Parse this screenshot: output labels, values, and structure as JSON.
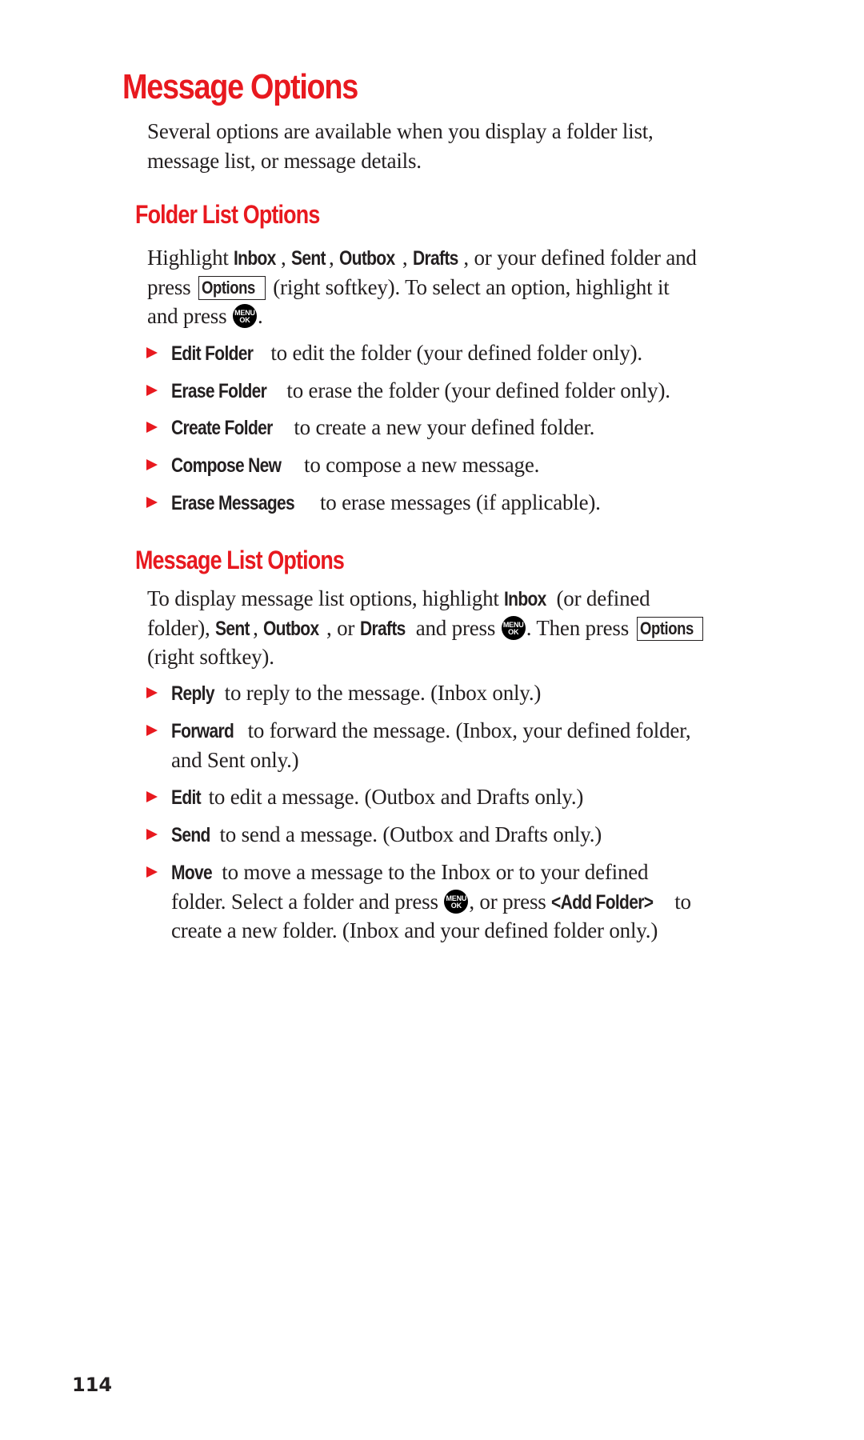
{
  "page": {
    "title": "Message Options",
    "intro": {
      "line1": "Several options are available when you display a folder list,",
      "line2": "message list, or message details."
    },
    "page_number": "114",
    "accent_color": "#e8191f"
  },
  "folder_list": {
    "heading": "Folder List Options",
    "para": {
      "l1_a": "Highlight ",
      "l1_inbox": "Inbox",
      "l1_c1": ", ",
      "l1_sent": "Sent",
      "l1_c2": ", ",
      "l1_outbox": "Outbox",
      "l1_c3": ", ",
      "l1_drafts": "Drafts",
      "l1_b": ", or your defined folder and",
      "l2_a": "press ",
      "l2_softkey": "Options",
      "l2_b": " (right softkey). To select an option, highlight it",
      "l3_a": "and press ",
      "l3_b": "."
    },
    "items": [
      {
        "term": "Edit Folder",
        "desc": " to edit the folder (your defined folder only)."
      },
      {
        "term": "Erase Folder",
        "desc": " to erase the folder (your defined folder only)."
      },
      {
        "term": "Create Folder",
        "desc": " to create a new your defined folder."
      },
      {
        "term": "Compose New",
        "desc": " to compose a new message."
      },
      {
        "term": "Erase Messages",
        "desc": " to erase messages (if applicable)."
      }
    ]
  },
  "message_list": {
    "heading": "Message List Options",
    "para": {
      "l1_a": "To display message list options, highlight ",
      "l1_inbox": "Inbox",
      "l1_b": " (or defined",
      "l2_a": "folder), ",
      "l2_sent": "Sent",
      "l2_c1": ", ",
      "l2_outbox": "Outbox",
      "l2_c2": ", or ",
      "l2_drafts": "Drafts",
      "l2_b": " and press ",
      "l2_c": ". Then press ",
      "l2_softkey": "Options",
      "l3": "(right softkey)."
    },
    "items": [
      {
        "term": "Reply",
        "desc": " to reply to the message. (Inbox only.)"
      },
      {
        "term": "Forward",
        "desc": " to forward the message. (Inbox, your defined folder,",
        "cont": "and Sent only.)"
      },
      {
        "term": "Edit",
        "desc": " to edit a message. (Outbox and Drafts only.)"
      },
      {
        "term": "Send",
        "desc": " to send a message. (Outbox and Drafts only.)"
      },
      {
        "term": "Move",
        "desc": " to move a message to the Inbox or to your defined",
        "cont_a": "folder. Select a folder and press ",
        "cont_b": ", or press ",
        "cont_term": "<Add Folder>",
        "cont_c": " to",
        "cont2": "create a new folder. (Inbox and your defined folder only.)"
      }
    ]
  },
  "icons": {
    "menu_ok": {
      "name": "menu-ok-key-icon",
      "line1": "MENU",
      "line2": "OK"
    },
    "bullet": {
      "name": "red-triangle-bullet-icon",
      "glyph": "▶"
    }
  }
}
